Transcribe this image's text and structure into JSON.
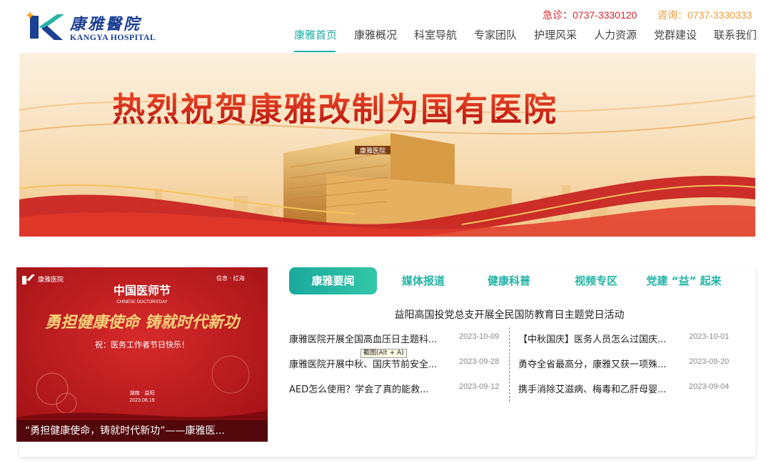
{
  "brand": {
    "name_cn": "康雅醫院",
    "name_en": "KANGYA HOSPITAL"
  },
  "hotlines": {
    "emergency": "急诊：0737-3330120",
    "consult": "咨询：0737-3330333"
  },
  "nav": {
    "items": [
      "康雅首页",
      "康雅概况",
      "科室导航",
      "专家团队",
      "护理风采",
      "人力资源",
      "党群建设",
      "联系我们"
    ],
    "active_index": 0
  },
  "banner": {
    "headline": "热烈祝贺康雅改制为国有医院",
    "building_sign": "康雅医院"
  },
  "feature": {
    "badge_left": "康雅医院",
    "badge_right": "信息 · 红海",
    "title": "中国医师节",
    "title_en": "CHINESE DOCTORS'DAY",
    "slogan": "勇担健康使命 铸就时代新功",
    "wish": "祝：医务工作者节日快乐！",
    "place": "湖南 · 益阳",
    "date": "2023.08.19",
    "caption": "“勇担健康使命，铸就时代新功”——康雅医..."
  },
  "tabs": [
    "康雅要闻",
    "媒体报道",
    "健康科普",
    "视频专区",
    "党建 “益” 起来"
  ],
  "headline": "益阳高国投党总支开展全民国防教育日主题党日活动",
  "news_left": [
    {
      "title": "康雅医院开展全国高血压日主题科...",
      "date": "2023-10-09"
    },
    {
      "title": "康雅医院开展中秋、国庆节前安全...",
      "date": "2023-09-28"
    },
    {
      "title": "AED怎么使用？学会了真的能救...",
      "date": "2023-09-12"
    }
  ],
  "news_right": [
    {
      "title": "【中秋国庆】医务人员怎么过国庆...",
      "date": "2023-10-01"
    },
    {
      "title": "勇夺全省最高分，康雅又获一项殊...",
      "date": "2023-09-20"
    },
    {
      "title": "携手消除艾滋病、梅毒和乙肝母婴...",
      "date": "2023-09-04"
    }
  ],
  "tooltip": "截图(Alt + A)",
  "colors": {
    "accent": "#1fae9f",
    "emergency": "#e0242b",
    "consult": "#f19a37",
    "brand_blue": "#1b3f93",
    "banner_red": "#c8201e"
  }
}
